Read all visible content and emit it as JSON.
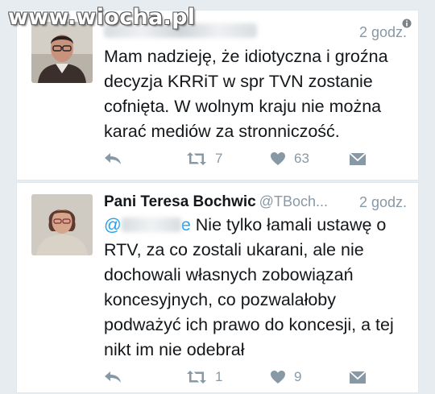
{
  "watermark": "www.wiocha.pl",
  "tweets": [
    {
      "author": "",
      "handle": "",
      "time": "2 godz.",
      "text": "Mam nadzieję, że idiotyczna i groźna decyzja KRRiT w spr TVN zostanie cofnięta. W wolnym kraju nie można karać mediów za stronniczość.",
      "retweets": "7",
      "likes": "63"
    },
    {
      "author": "Pani Teresa Bochwic",
      "handle": "@TBoch...",
      "time": "2 godz.",
      "mention": "@",
      "mention_tail": "e",
      "text": " Nie tylko łamali ustawę o RTV, za co zostali ukarani, ale nie dochowali własnych zobowiązań koncesyjnych, co pozwalałoby podważyć ich prawo do koncesji, a tej nikt im nie odebrał",
      "retweets": "1",
      "likes": "9"
    }
  ],
  "colors": {
    "background": "#e6ecf0",
    "muted": "#8899a6",
    "text": "#14171a",
    "link": "#1da1f2"
  }
}
